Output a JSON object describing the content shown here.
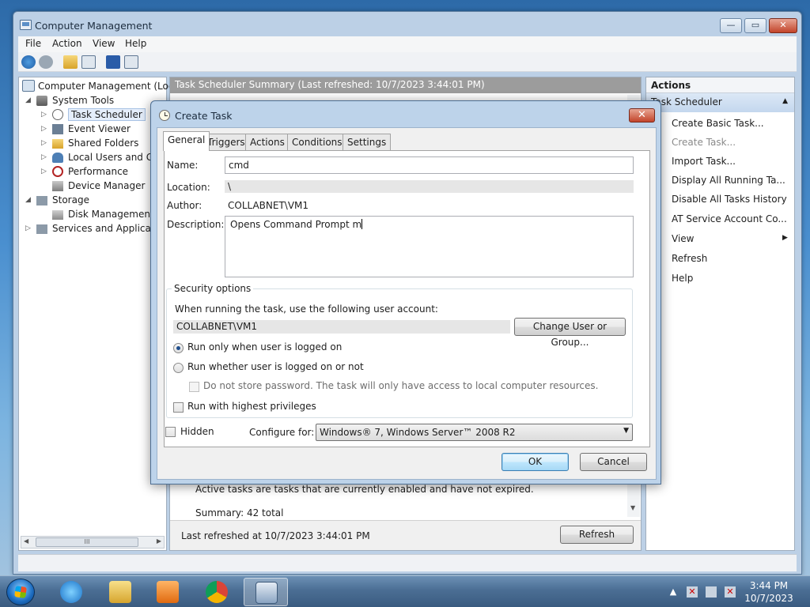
{
  "window": {
    "title": "Computer Management",
    "controls": {
      "minimize": "—",
      "maximize": "▭",
      "close": "✕"
    }
  },
  "menu": [
    "File",
    "Action",
    "View",
    "Help"
  ],
  "tree": {
    "root": "Computer Management (Local",
    "system_tools": "System Tools",
    "task_scheduler": "Task Scheduler",
    "event_viewer": "Event Viewer",
    "shared_folders": "Shared Folders",
    "local_users": "Local Users and Gro",
    "performance": "Performance",
    "device_manager": "Device Manager",
    "storage": "Storage",
    "disk_management": "Disk Management",
    "services": "Services and Application",
    "scroll_grip": "III"
  },
  "center": {
    "header": "Task Scheduler Summary (Last refreshed: 10/7/2023 3:44:01 PM)",
    "active_tasks_text": "Active tasks are tasks that are currently enabled and have not expired.",
    "summary": "Summary: 42 total",
    "last_refreshed": "Last refreshed at 10/7/2023 3:44:01 PM",
    "refresh_button": "Refresh"
  },
  "actions": {
    "title": "Actions",
    "group": "Task Scheduler",
    "items": [
      {
        "label": "Create Basic Task...",
        "enabled": true
      },
      {
        "label": "Create Task...",
        "enabled": false
      },
      {
        "label": "Import Task...",
        "enabled": true
      },
      {
        "label": "Display All Running Ta...",
        "enabled": true
      },
      {
        "label": "Disable All Tasks History",
        "enabled": true
      },
      {
        "label": "AT Service Account Co...",
        "enabled": true
      },
      {
        "label": "View",
        "enabled": true
      },
      {
        "label": "Refresh",
        "enabled": true
      },
      {
        "label": "Help",
        "enabled": true
      }
    ]
  },
  "dialog": {
    "title": "Create Task",
    "close": "✕",
    "tabs": [
      "General",
      "Triggers",
      "Actions",
      "Conditions",
      "Settings"
    ],
    "active_tab": "General",
    "name_label": "Name:",
    "name_value": "cmd",
    "location_label": "Location:",
    "location_value": "\\",
    "author_label": "Author:",
    "author_value": "COLLABNET\\VM1",
    "description_label": "Description:",
    "description_value": "Opens Command Prompt m",
    "security": {
      "legend": "Security options",
      "account_prompt": "When running the task, use the following user account:",
      "account_value": "COLLABNET\\VM1",
      "change_button": "Change User or Group...",
      "radio_logged_on": "Run only when user is logged on",
      "radio_logged_on_or_not": "Run whether user is logged on or not",
      "no_store_password": "Do not store password.  The task will only have access to local computer resources.",
      "highest_privileges": "Run with highest privileges"
    },
    "hidden_label": "Hidden",
    "configure_label": "Configure for:",
    "configure_value": "Windows® 7, Windows Server™ 2008 R2",
    "ok": "OK",
    "cancel": "Cancel"
  },
  "taskbar": {
    "time": "3:44 PM",
    "date": "10/7/2023"
  },
  "colors": {
    "selection": "#e5eefb",
    "header_gray": "#9c9c9c",
    "accent_blue": "#3c7fb1"
  }
}
